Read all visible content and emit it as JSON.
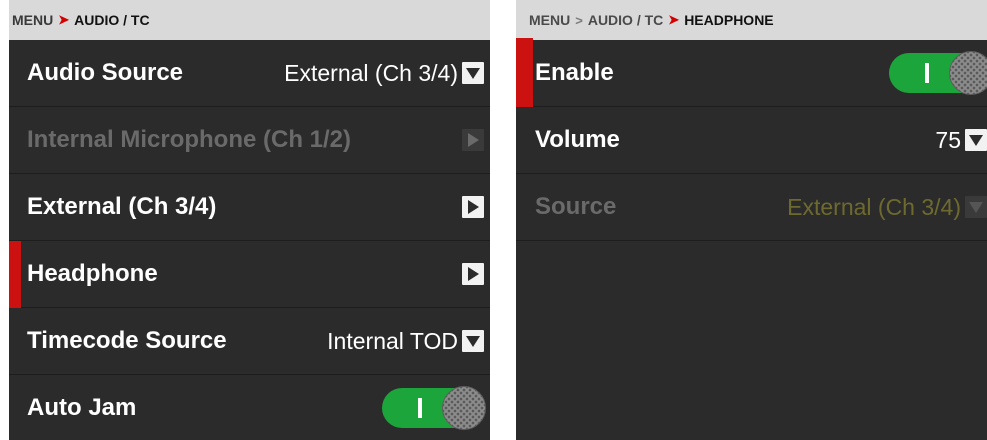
{
  "left": {
    "breadcrumb": {
      "parent": "MENU",
      "separator": "➤",
      "current": "AUDIO / TC"
    },
    "rows": [
      {
        "label": "Audio Source",
        "value": "External (Ch 3/4)"
      },
      {
        "label": "Internal Microphone (Ch 1/2)"
      },
      {
        "label": "External (Ch 3/4)"
      },
      {
        "label": "Headphone"
      },
      {
        "label": "Timecode Source",
        "value": "Internal TOD"
      },
      {
        "label": "Auto Jam"
      }
    ]
  },
  "right": {
    "breadcrumb": {
      "parent": "MENU",
      "middle": "AUDIO / TC",
      "separator": "➤",
      "current": "HEADPHONE"
    },
    "rows": [
      {
        "label": "Enable"
      },
      {
        "label": "Volume",
        "value": "75"
      },
      {
        "label": "Source",
        "value": "External (Ch 3/4)"
      }
    ]
  },
  "colors": {
    "accent": "#cc1111",
    "toggle_on": "#1ca53a",
    "panel_bg": "#2b2b2b",
    "disabled_value": "#6e6a2f"
  },
  "icons": {
    "dropdown": "triangle-down-icon",
    "submenu": "triangle-right-icon"
  }
}
